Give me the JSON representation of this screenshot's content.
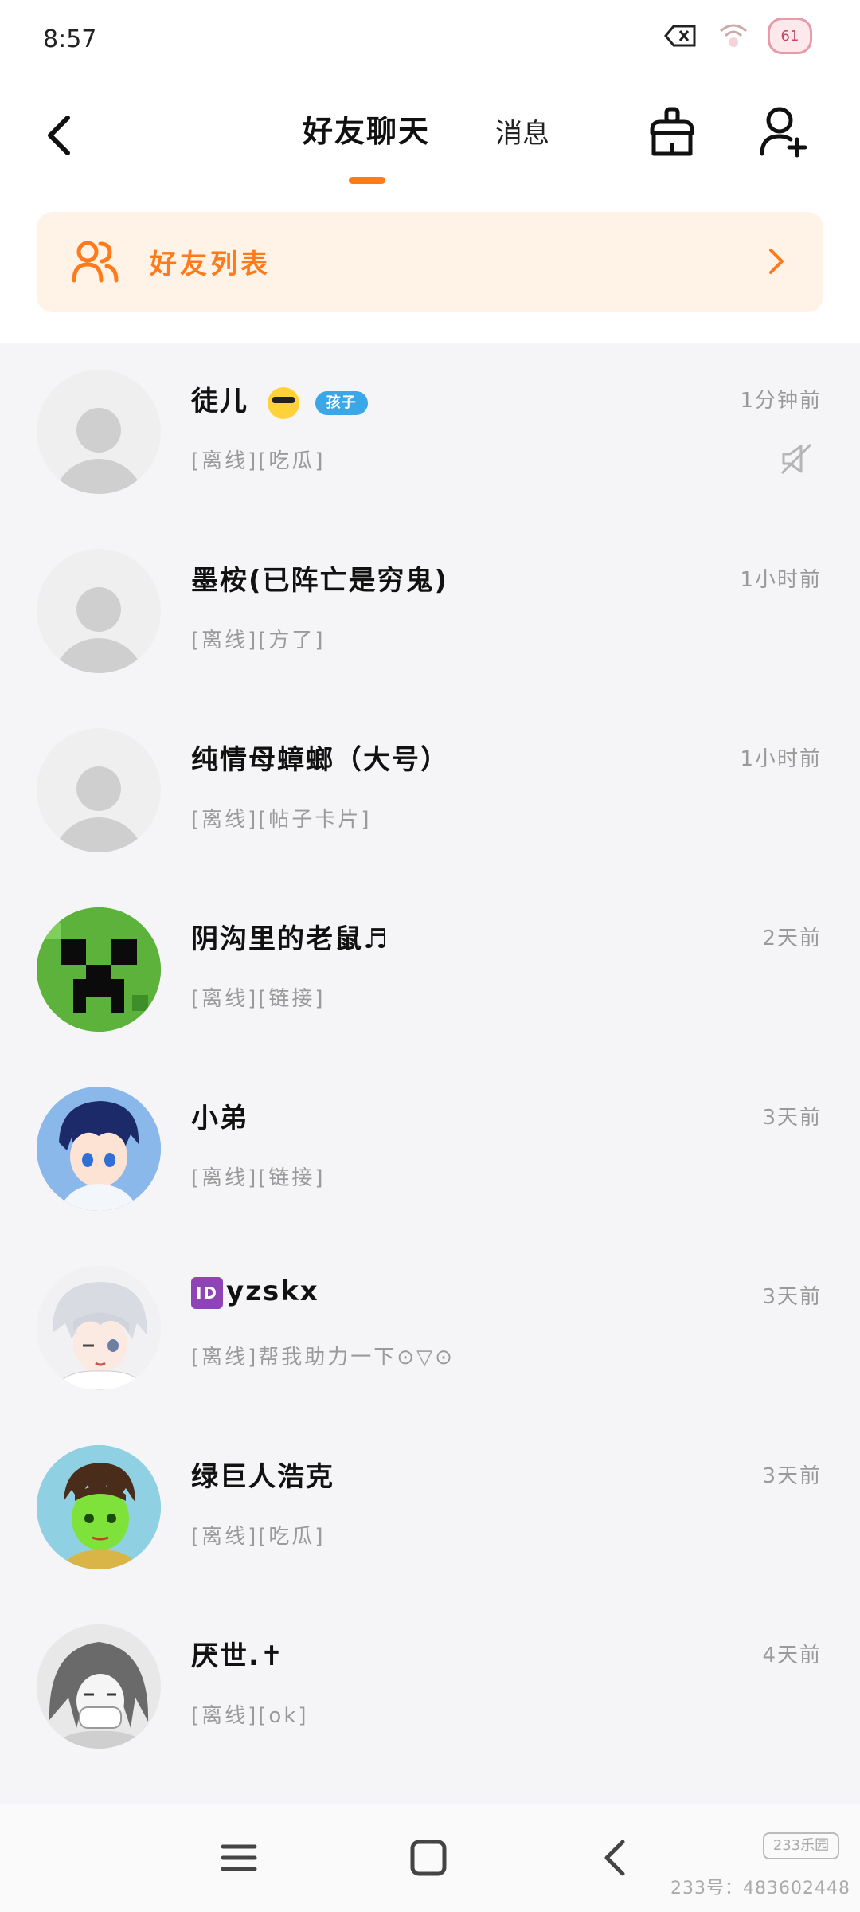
{
  "status": {
    "time": "8:57",
    "battery": "61"
  },
  "header": {
    "tab_friend_chat": "好友聊天",
    "tab_messages": "消息",
    "accent": "#ff7a1a"
  },
  "banner": {
    "label": "好友列表"
  },
  "chats": [
    {
      "name": "徒儿",
      "badge": "孩子",
      "status": "[离线][吃瓜]",
      "time": "1分钟前",
      "muted": true,
      "avatar": "default"
    },
    {
      "name": "墨桉(已阵亡是穷鬼)",
      "status": "[离线][方了]",
      "time": "1小时前",
      "avatar": "default"
    },
    {
      "name": "纯情母蟑螂（大号）",
      "status": "[离线][帖子卡片]",
      "time": "1小时前",
      "avatar": "default"
    },
    {
      "name": "阴沟里的老鼠♬",
      "status": "[离线][链接]",
      "time": "2天前",
      "avatar": "creeper"
    },
    {
      "name": "小弟",
      "status": "[离线][链接]",
      "time": "3天前",
      "avatar": "anime1"
    },
    {
      "id_icon": "ID",
      "name": "yzskx",
      "status": "[离线]帮我助力一下⊙▽⊙",
      "time": "3天前",
      "avatar": "anime2"
    },
    {
      "name": "绿巨人浩克",
      "status": "[离线][吃瓜]",
      "time": "3天前",
      "avatar": "anime3"
    },
    {
      "name": "厌世.✝",
      "status": "[离线][ok]",
      "time": "4天前",
      "avatar": "anime4"
    }
  ],
  "watermark": {
    "logo": "233乐园",
    "text": "233号：483602448"
  }
}
